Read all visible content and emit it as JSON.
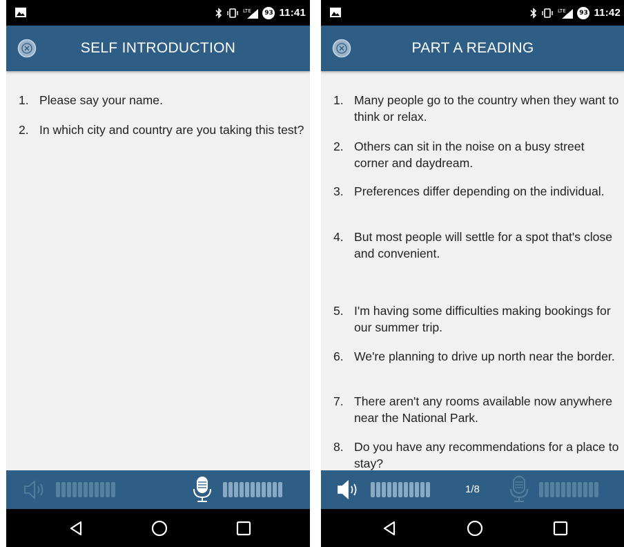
{
  "screens": [
    {
      "status": {
        "time": "11:41",
        "battery": "93",
        "network": "LTE"
      },
      "header": {
        "title": "SELF INTRODUCTION"
      },
      "items": [
        {
          "num": "1.",
          "text": "Please say your name."
        },
        {
          "num": "2.",
          "text": "In which city and country are you taking this test?"
        }
      ],
      "controls": {
        "speaker_state": "disabled",
        "mic_state": "active"
      }
    },
    {
      "status": {
        "time": "11:42",
        "battery": "93",
        "network": "LTE"
      },
      "header": {
        "title": "PART A READING"
      },
      "items": [
        {
          "num": "1.",
          "text": "Many people go to the country when they want to think or relax."
        },
        {
          "num": "2.",
          "text": "Others can sit in the noise on a busy street corner and daydream."
        },
        {
          "num": "3.",
          "text": "Preferences differ depending on the individual."
        },
        {
          "num": "4.",
          "text": "But most people will settle for a spot that's close and convenient."
        },
        {
          "num": "5.",
          "text": "I'm having some difficulties making bookings for our summer trip."
        },
        {
          "num": "6.",
          "text": "We're planning to drive up north near the border."
        },
        {
          "num": "7.",
          "text": "There aren't any rooms available now anywhere near the National Park."
        },
        {
          "num": "8.",
          "text": "Do you have any recommendations for a place to stay?"
        }
      ],
      "controls": {
        "speaker_state": "active",
        "mic_state": "disabled",
        "counter": "1/8"
      }
    }
  ],
  "icons": {
    "close": "close-circle-icon",
    "speaker": "speaker-icon",
    "mic": "microphone-icon",
    "back": "back-triangle-icon",
    "home": "home-circle-icon",
    "recents": "recents-square-icon"
  },
  "colors": {
    "app_bar": "#2e5d85",
    "background": "#f1f1f1",
    "status_bar": "#000000",
    "text": "#222222"
  }
}
